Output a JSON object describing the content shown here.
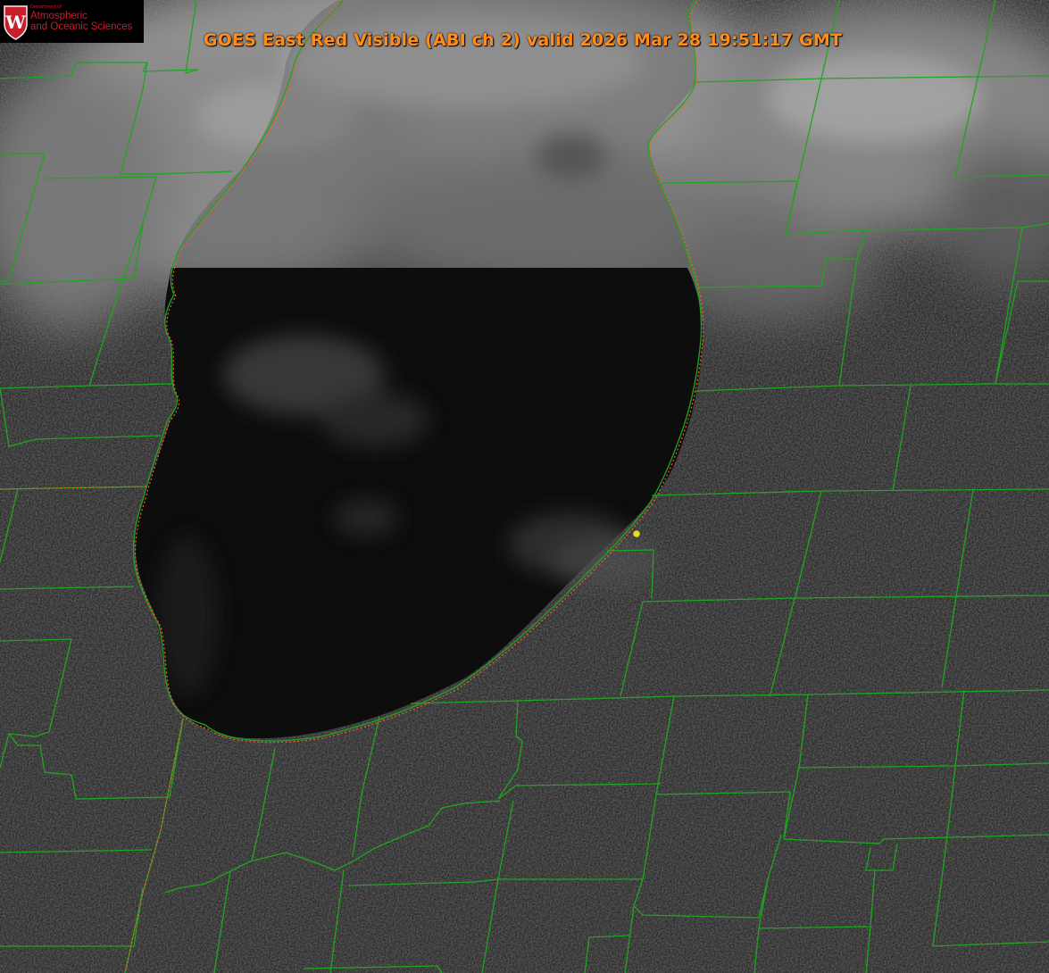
{
  "title": "GOES East Red Visible (ABI ch 2) valid 2026 Mar 28 19:51:17 GMT",
  "logo": {
    "department": "Department of",
    "line1": "Atmospheric",
    "line2": "and Oceanic Sciences",
    "crest_letter": "W"
  },
  "colors": {
    "title": "#ff8c1a",
    "county_lines": "#1fa51f",
    "state_line": "#ff5a2a",
    "marker": "#e0e020",
    "lake": "#0c0c0c",
    "logo_red": "#c81f2c"
  },
  "map": {
    "layer": "satellite-visible-imagery",
    "features": [
      "county-boundaries",
      "state-boundary",
      "lake-shoreline",
      "location-marker"
    ]
  }
}
